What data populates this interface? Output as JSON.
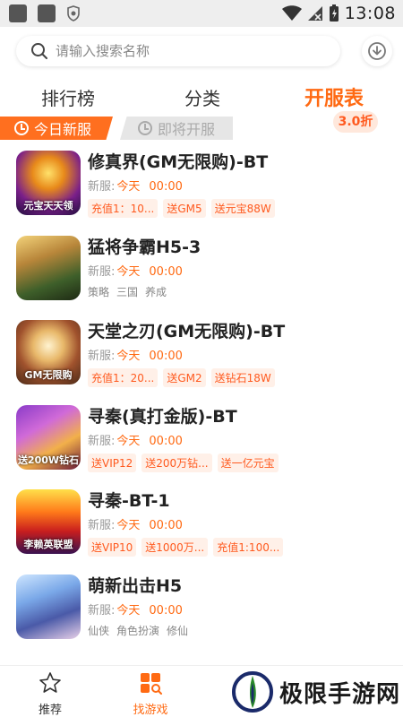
{
  "status_bar": {
    "time": "13:08"
  },
  "search": {
    "placeholder": "请输入搜索名称"
  },
  "main_tabs": [
    {
      "label": "排行榜",
      "active": false
    },
    {
      "label": "分类",
      "active": false
    },
    {
      "label": "开服表",
      "active": true
    }
  ],
  "sub_tabs": [
    {
      "label": "今日新服",
      "active": true
    },
    {
      "label": "即将开服",
      "active": false
    }
  ],
  "games": [
    {
      "name": "修真界(GM无限购)-BT",
      "open_label": "新服:",
      "open_day": "今天",
      "open_time": "00:00",
      "icon_text": "元宝天天领",
      "tags": [
        "充值1：10...",
        "送GM5",
        "送元宝88W"
      ],
      "tag_style": "promo"
    },
    {
      "name": "猛将争霸H5-3",
      "open_label": "新服:",
      "open_day": "今天",
      "open_time": "00:00",
      "icon_text": "",
      "tags": [
        "策略",
        "三国",
        "养成"
      ],
      "tag_style": "plain",
      "discount": "3.0折"
    },
    {
      "name": "天堂之刃(GM无限购)-BT",
      "open_label": "新服:",
      "open_day": "今天",
      "open_time": "00:00",
      "icon_text": "GM无限购",
      "tags": [
        "充值1：20...",
        "送GM2",
        "送钻石18W"
      ],
      "tag_style": "promo"
    },
    {
      "name": "寻秦(真打金版)-BT",
      "open_label": "新服:",
      "open_day": "今天",
      "open_time": "00:00",
      "icon_text": "送200W钻石",
      "tags": [
        "送VIP12",
        "送200万钻...",
        "送一亿元宝"
      ],
      "tag_style": "promo"
    },
    {
      "name": "寻秦-BT-1",
      "open_label": "新服:",
      "open_day": "今天",
      "open_time": "00:00",
      "icon_text": "李赖英联盟",
      "tags": [
        "送VIP10",
        "送1000万...",
        "充值1:100..."
      ],
      "tag_style": "promo"
    },
    {
      "name": "萌新出击H5",
      "open_label": "新服:",
      "open_day": "今天",
      "open_time": "00:00",
      "icon_text": "",
      "tags": [
        "仙侠",
        "角色扮演",
        "修仙"
      ],
      "tag_style": "plain"
    }
  ],
  "bottom_nav": [
    {
      "label": "推荐",
      "icon": "star-icon",
      "active": false
    },
    {
      "label": "找游戏",
      "icon": "game-grid-icon",
      "active": true
    }
  ],
  "watermark": {
    "text": "极限手游网"
  },
  "colors": {
    "accent": "#ff6a13",
    "tag_bg": "#fff0e8",
    "inactive_tab": "#e6e6e6"
  }
}
